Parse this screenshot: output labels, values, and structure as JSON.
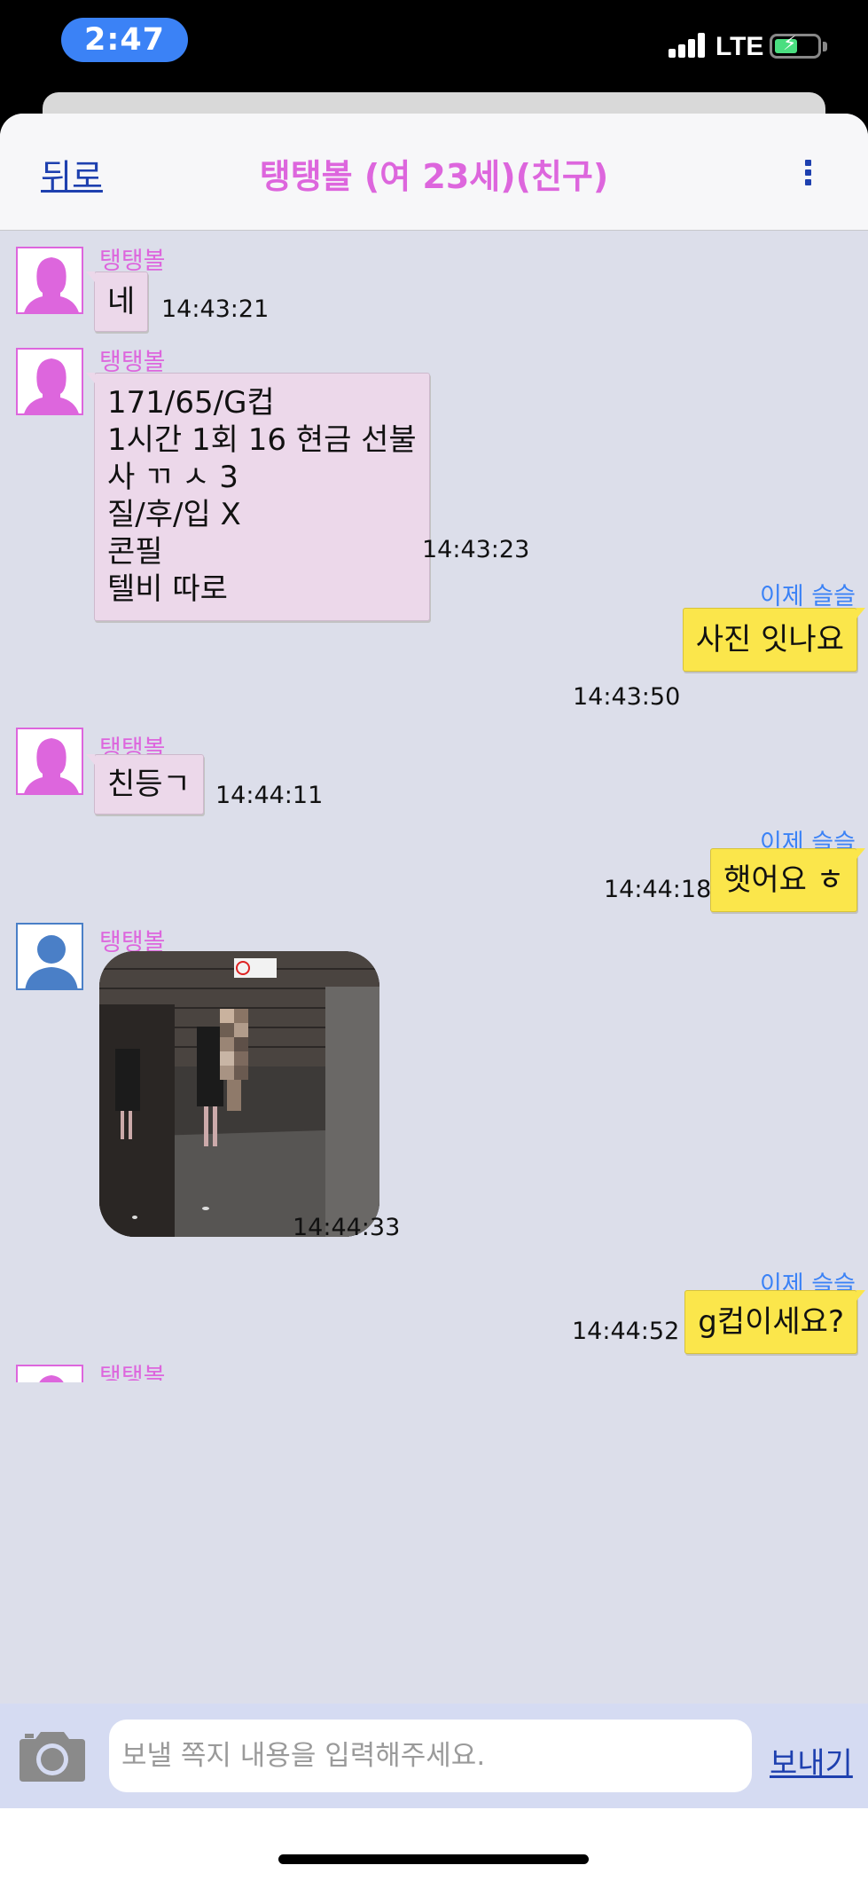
{
  "status_bar": {
    "time": "2:47",
    "network": "LTE"
  },
  "header": {
    "back_label": "뒤로",
    "title": "탱탱볼 (여 23세)(친구)",
    "menu_icon": "more-vertical-icon"
  },
  "me": {
    "name": "이제 슬슬"
  },
  "other": {
    "name": "탱탱볼"
  },
  "messages": [
    {
      "from": "other",
      "text": "네",
      "time": "14:43:21"
    },
    {
      "from": "other",
      "lines": [
        "171/65/G컵",
        "1시간 1회 16 현금 선불",
        "사 ㄲ ㅅ  3",
        "질/후/입 X",
        "콘필",
        "텔비 따로"
      ],
      "time": "14:43:23"
    },
    {
      "from": "me",
      "text": "사진 잇나요",
      "time": "14:43:50"
    },
    {
      "from": "other",
      "text": "친등ㄱ",
      "time": "14:44:11"
    },
    {
      "from": "me",
      "text": "햇어요 ㅎ",
      "time": "14:44:18"
    },
    {
      "from": "other",
      "photo": "photo-message",
      "time": "14:44:33"
    },
    {
      "from": "me",
      "text": "g컵이세요?",
      "time": "14:44:52"
    }
  ],
  "input": {
    "placeholder": "보낼 쪽지 내용을 입력해주세요.",
    "value": "",
    "send_label": "보내기",
    "camera_icon": "camera-icon"
  },
  "colors": {
    "accent_name": "#dd66dd",
    "me_name": "#3b82f6",
    "link": "#1e40af",
    "bubble_in": "#ecd8ea",
    "bubble_out": "#fbe64b",
    "chat_bg": "#dcdeea"
  }
}
